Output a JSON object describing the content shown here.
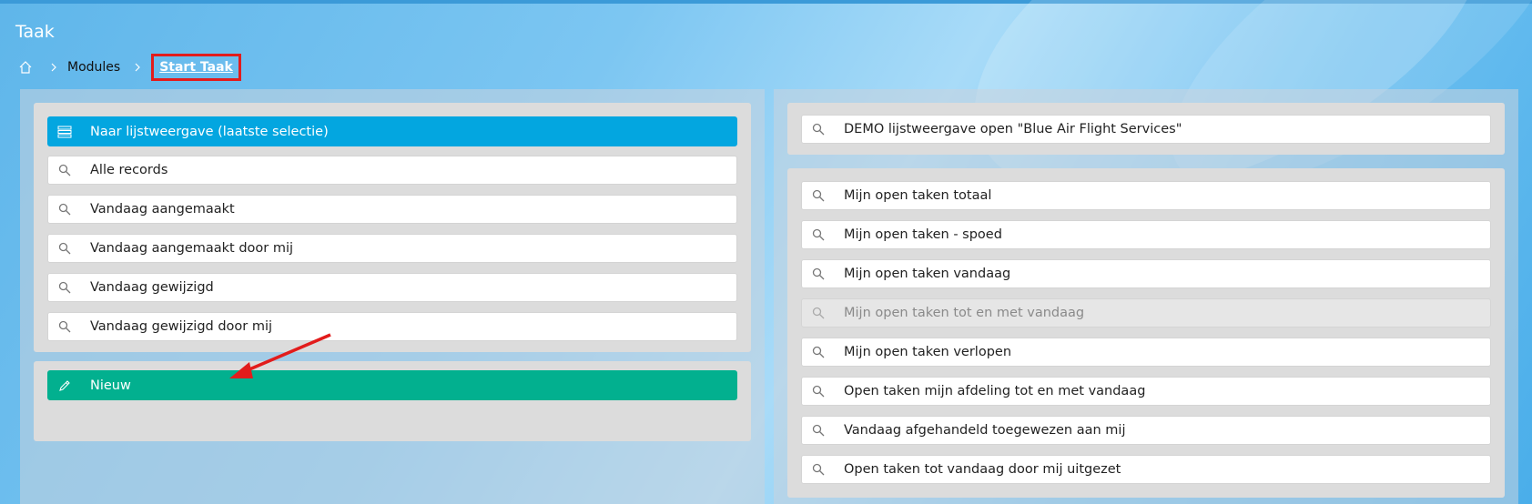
{
  "page": {
    "title": "Taak"
  },
  "breadcrumb": {
    "home_icon": "home-icon",
    "items": [
      "Modules",
      "Start Taak"
    ]
  },
  "left": {
    "list_button_label": "Naar lijstweergave (laatste selectie)",
    "searches": [
      "Alle records",
      "Vandaag aangemaakt",
      "Vandaag aangemaakt door mij",
      "Vandaag gewijzigd",
      "Vandaag gewijzigd door mij"
    ],
    "new_button_label": "Nieuw"
  },
  "right": {
    "demo_label": "DEMO lijstweergave open \"Blue Air Flight Services\"",
    "searches": [
      "Mijn open taken totaal",
      "Mijn open taken - spoed",
      "Mijn open taken vandaag",
      "Mijn open taken tot en met vandaag",
      "Mijn open taken verlopen",
      "Open taken mijn afdeling tot en met vandaag",
      "Vandaag afgehandeld toegewezen aan mij",
      "Open taken tot vandaag door mij uitgezet"
    ],
    "disabled_index": 3
  },
  "colors": {
    "accent_blue": "#03a6e0",
    "accent_green": "#02b08f",
    "highlight_red": "#e21c1c"
  }
}
